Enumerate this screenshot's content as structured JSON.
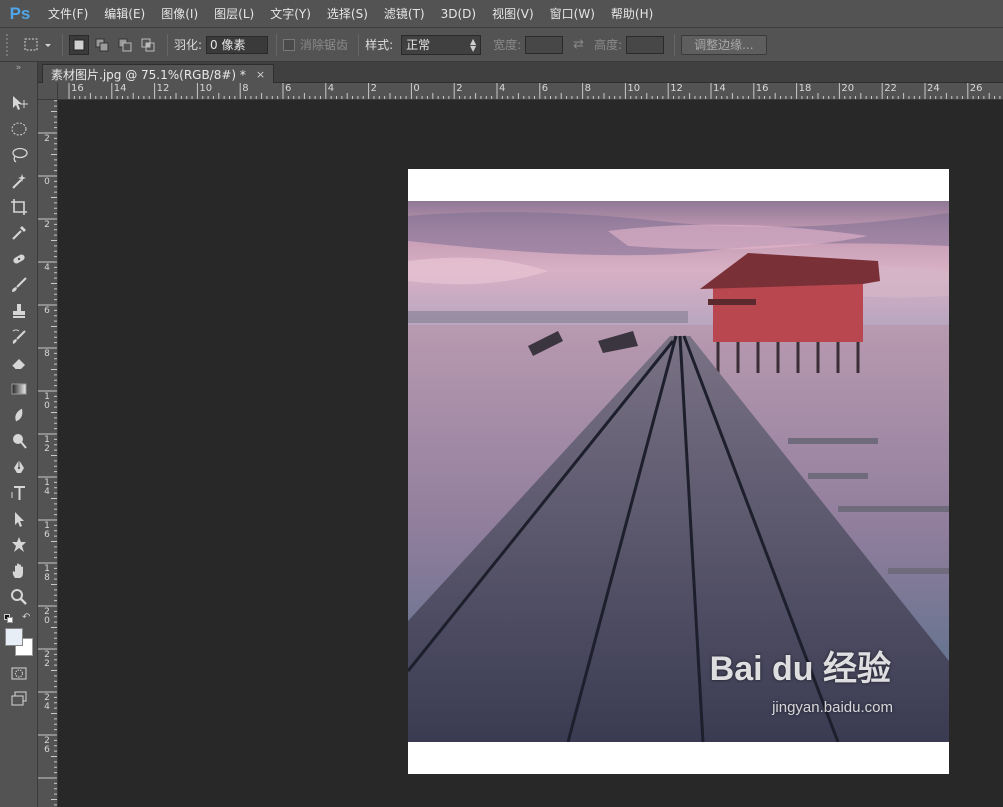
{
  "app": {
    "logo": "Ps"
  },
  "menu": [
    "文件(F)",
    "编辑(E)",
    "图像(I)",
    "图层(L)",
    "文字(Y)",
    "选择(S)",
    "滤镜(T)",
    "3D(D)",
    "视图(V)",
    "窗口(W)",
    "帮助(H)"
  ],
  "options": {
    "feather_label": "羽化:",
    "feather_value": "0 像素",
    "antialias_label": "消除锯齿",
    "style_label": "样式:",
    "style_value": "正常",
    "width_label": "宽度:",
    "height_label": "高度:",
    "refine_edge_label": "调整边缘..."
  },
  "document": {
    "tab_title": "素材图片.jpg @ 75.1%(RGB/8#) *",
    "close_glyph": "×"
  },
  "rulers": {
    "horizontal": [
      "16",
      "14",
      "12",
      "10",
      "8",
      "6",
      "4",
      "2",
      "0",
      "2",
      "4",
      "6",
      "8",
      "10",
      "12",
      "14",
      "16",
      "18",
      "20",
      "22",
      "24",
      "26"
    ],
    "vertical": [
      "2",
      "0",
      "2",
      "4",
      "6",
      "8",
      "10",
      "12",
      "14",
      "16",
      "18",
      "20",
      "22",
      "24",
      "26"
    ]
  },
  "toolbar": {
    "icons": [
      "move-icon",
      "ellipse-marquee-icon",
      "lasso-icon",
      "magic-wand-icon",
      "crop-icon",
      "eyedropper-icon",
      "spot-healing-icon",
      "brush-icon",
      "clone-stamp-icon",
      "history-brush-icon",
      "eraser-icon",
      "gradient-icon",
      "blur-icon",
      "dodge-icon",
      "pen-icon",
      "type-icon",
      "path-selection-icon",
      "custom-shape-icon",
      "hand-icon",
      "zoom-icon"
    ],
    "foreground_color": "#e8eef6",
    "background_color": "#ffffff"
  },
  "watermark": {
    "brand": "Bai du 经验",
    "url": "jingyan.baidu.com"
  }
}
